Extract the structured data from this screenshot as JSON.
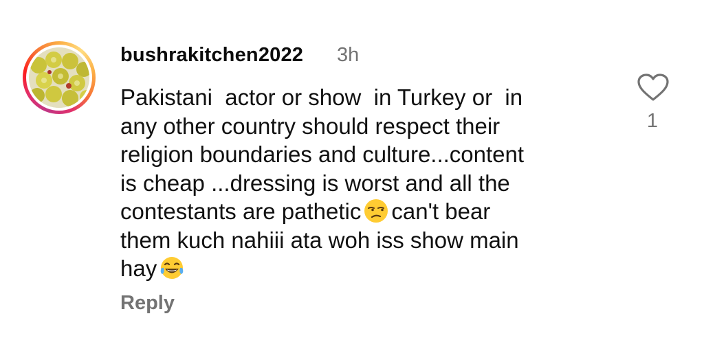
{
  "comment": {
    "username": "bushrakitchen2022",
    "timestamp": "3h",
    "lines": [
      "Pakistani  actor or show  in Turkey or  in",
      "any other country should respect their",
      "religion boundaries and culture...content",
      "is cheap ...dressing is worst and all the",
      "contestants are pathetic",
      "can't bear",
      "them kuch nahiii ata woh iss show main",
      "hay"
    ],
    "reply_label": "Reply",
    "like_count": "1",
    "avatar_icon": "avatar",
    "like_icon": "heart-outline-icon",
    "emojis": [
      "unamused-face-emoji",
      "tears-of-joy-emoji"
    ]
  },
  "colors": {
    "username": "#0b0b0b",
    "muted": "#737373",
    "ring_start": "#c13584",
    "ring_end": "#fcaf45",
    "emoji_yellow": "#ffcc33"
  }
}
